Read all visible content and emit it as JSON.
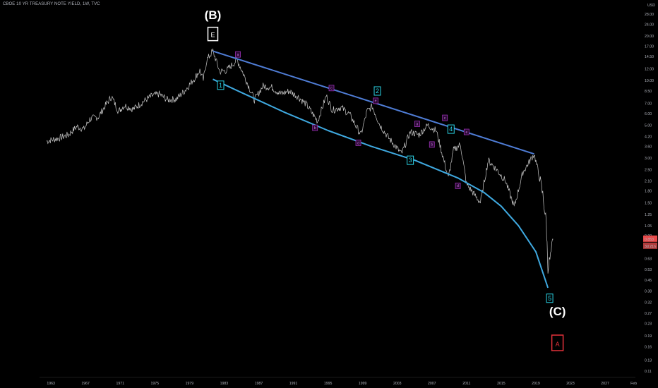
{
  "header": {
    "title": "CBOE 10 YR TREASURY NOTE YIELD, 1W, TVC"
  },
  "axis": {
    "currency": "USD",
    "y_ticks": [
      "28.00",
      "24.00",
      "20.00",
      "17.00",
      "14.50",
      "12.00",
      "10.00",
      "8.50",
      "7.00",
      "6.00",
      "5.00",
      "4.20",
      "3.60",
      "3.00",
      "2.50",
      "2.10",
      "1.80",
      "1.50",
      "1.25",
      "1.05",
      "0.90",
      "0.75",
      "0.63",
      "0.53",
      "0.45",
      "0.38",
      "0.32",
      "0.27",
      "0.23",
      "0.19",
      "0.16",
      "0.13",
      "0.11"
    ],
    "x_ticks": [
      "1963",
      "1967",
      "1971",
      "1975",
      "1979",
      "1983",
      "1987",
      "1991",
      "1995",
      "1999",
      "2003",
      "2007",
      "2011",
      "2015",
      "2019",
      "2023",
      "2027",
      "Feb"
    ],
    "scale": "log",
    "ylim": [
      0.105,
      32.0
    ]
  },
  "price": {
    "last": "0.853",
    "countdown": "3d 21h"
  },
  "colors": {
    "background": "#000000",
    "price_line": "#c8c8c8",
    "upper_channel": "#4f7dd6",
    "lower_curve": "#3fa9e0",
    "box_cyan": "#2ad4e6",
    "box_purple": "#9b30b5",
    "red_label": "#e5323b",
    "price_badge": "#e84a4a"
  },
  "labels": {
    "wave_b": "(B)",
    "wave_e": "E",
    "wave_c": "(C)",
    "wave_a": "A",
    "impulse": [
      "1",
      "2",
      "3",
      "4",
      "5"
    ],
    "sub": [
      "a",
      "b",
      "c",
      "d",
      "e",
      "a",
      "b",
      "c",
      "d",
      "e"
    ]
  },
  "chart_data": {
    "type": "line",
    "title": "CBOE 10 YR TREASURY NOTE YIELD, 1W, TVC",
    "y_scale": "log",
    "ylim": [
      0.105,
      32.0
    ],
    "xlim": [
      1962.5,
      2030.5
    ],
    "series": [
      {
        "name": "CBOE 10 YR TREASURY NOTE YIELD",
        "x": [
          1962.5,
          1964,
          1965,
          1966,
          1966.8,
          1967.5,
          1968.5,
          1969.3,
          1970,
          1970.8,
          1971.5,
          1972.5,
          1973.8,
          1974.7,
          1975.5,
          1976.5,
          1977.5,
          1978.5,
          1979.5,
          1980.2,
          1980.6,
          1981.0,
          1981.7,
          1982.5,
          1983.3,
          1984.5,
          1985.5,
          1986.5,
          1987.5,
          1988.5,
          1989.5,
          1990.5,
          1991.5,
          1992.5,
          1993.8,
          1994.8,
          1995.5,
          1996.5,
          1997.5,
          1998.8,
          1999.5,
          2000.1,
          2001.0,
          2002.0,
          2003.5,
          2004.5,
          2005.5,
          2006.5,
          2007.5,
          2008.9,
          2009.5,
          2010.3,
          2011.0,
          2012.6,
          2013.5,
          2014.5,
          2015.5,
          2016.5,
          2017.5,
          2018.8,
          2019.3,
          2019.8,
          2020.2,
          2020.4,
          2020.7,
          2021.0
        ],
        "values": [
          3.9,
          4.1,
          4.3,
          4.9,
          4.7,
          5.5,
          5.7,
          6.8,
          7.8,
          6.2,
          6.8,
          6.4,
          7.3,
          7.9,
          8.1,
          7.4,
          7.5,
          8.6,
          10.2,
          11.7,
          10.1,
          13.8,
          15.8,
          11.5,
          11.7,
          13.8,
          10.2,
          7.4,
          9.2,
          9.0,
          8.1,
          8.5,
          7.8,
          6.9,
          5.3,
          7.9,
          6.3,
          6.6,
          5.9,
          4.3,
          6.2,
          6.7,
          5.0,
          4.1,
          3.2,
          4.5,
          4.3,
          5.0,
          4.6,
          2.2,
          3.4,
          3.7,
          2.0,
          1.5,
          2.9,
          2.5,
          2.1,
          1.4,
          2.4,
          3.2,
          2.4,
          1.7,
          1.1,
          0.55,
          0.65,
          0.85
        ]
      }
    ],
    "annotations": {
      "upper_channel": {
        "x": [
          1981.7,
          2018.8
        ],
        "y": [
          15.8,
          3.2
        ]
      },
      "lower_curve": {
        "x": [
          1981.7,
          1985,
          1990,
          1995,
          2000,
          2005,
          2010,
          2013,
          2015,
          2017,
          2019,
          2020.4
        ],
        "y": [
          10.2,
          8.3,
          6.1,
          4.6,
          3.6,
          2.9,
          2.2,
          1.76,
          1.42,
          1.05,
          0.7,
          0.4
        ]
      },
      "wave_labels": [
        {
          "text": "(B)",
          "x": 1981.7,
          "y": 26
        },
        {
          "text": "E",
          "x": 1981.7,
          "y": 20.5
        },
        {
          "text": "(C)",
          "x": 2021.5,
          "y": 0.26
        },
        {
          "text": "A",
          "x": 2021.5,
          "y": 0.17
        }
      ],
      "impulse_labels": [
        {
          "text": "1",
          "x": 1982.6,
          "y": 9.3
        },
        {
          "text": "2",
          "x": 2000.7,
          "y": 8.5
        },
        {
          "text": "3",
          "x": 2004.5,
          "y": 2.9
        },
        {
          "text": "4",
          "x": 2009.2,
          "y": 4.7
        },
        {
          "text": "5",
          "x": 2020.6,
          "y": 0.34
        }
      ],
      "sub_labels": [
        {
          "text": "a",
          "x": 1984.6,
          "y": 15.0
        },
        {
          "text": "b",
          "x": 1993.5,
          "y": 4.8
        },
        {
          "text": "c",
          "x": 1995.4,
          "y": 8.9
        },
        {
          "text": "d",
          "x": 1998.5,
          "y": 3.8
        },
        {
          "text": "e",
          "x": 2000.5,
          "y": 7.3
        },
        {
          "text": "a",
          "x": 2005.3,
          "y": 5.1
        },
        {
          "text": "b",
          "x": 2007.0,
          "y": 3.7
        },
        {
          "text": "c",
          "x": 2008.5,
          "y": 5.6
        },
        {
          "text": "d",
          "x": 2010.0,
          "y": 1.95
        },
        {
          "text": "e",
          "x": 2011.0,
          "y": 4.5
        }
      ]
    }
  }
}
